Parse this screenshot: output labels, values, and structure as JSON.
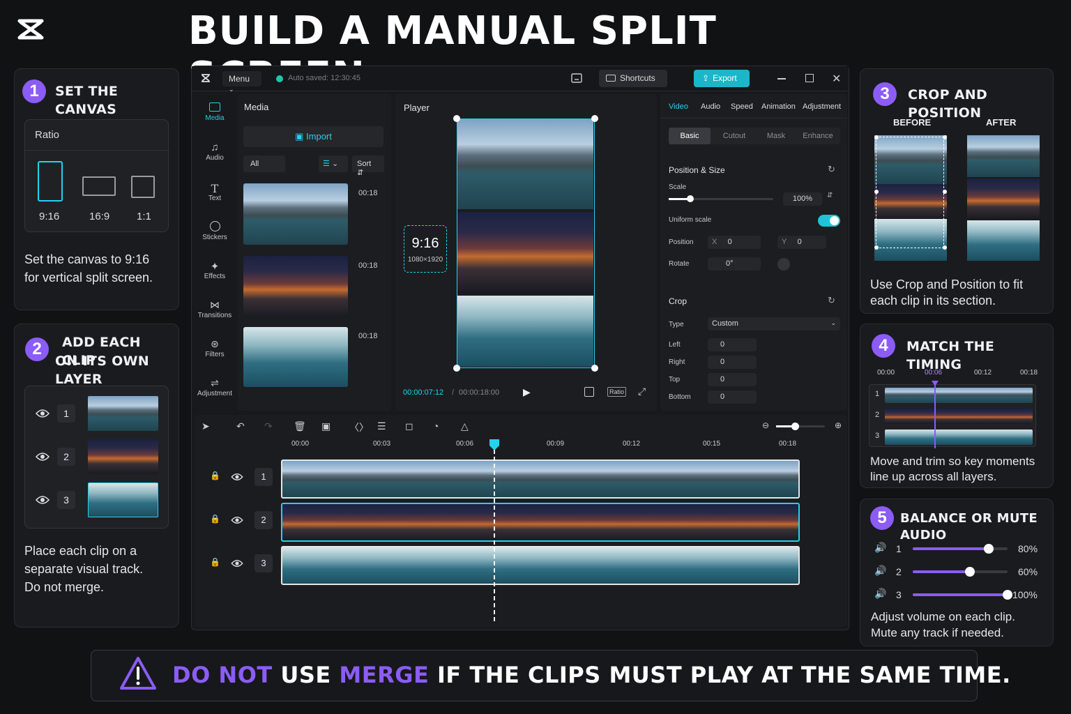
{
  "title": "BUILD A MANUAL SPLIT SCREEN",
  "step1": {
    "num": "1",
    "title": "SET THE CANVAS",
    "ratio_label": "Ratio",
    "ratios": [
      "9:16",
      "16:9",
      "1:1"
    ],
    "desc_line1": "Set the canvas to 9:16",
    "desc_line2": "for vertical split screen."
  },
  "step2": {
    "num": "2",
    "title_line1": "ADD EACH CLIP",
    "title_line2": "ON ITS OWN LAYER",
    "layers": [
      "1",
      "2",
      "3"
    ],
    "desc_line1": "Place each clip on a",
    "desc_line2": "separate visual track.",
    "desc_line3": "Do not merge."
  },
  "step3": {
    "num": "3",
    "title": "CROP AND POSITION",
    "before": "BEFORE",
    "after": "AFTER",
    "desc_line1": "Use Crop and Position to fit",
    "desc_line2": "each clip in its section."
  },
  "step4": {
    "num": "4",
    "title": "MATCH THE TIMING",
    "ticks": [
      "00:00",
      "00:06",
      "00:12",
      "00:18"
    ],
    "tracks": [
      "1",
      "2",
      "3"
    ],
    "desc_line1": "Move and trim so key moments",
    "desc_line2": "line up across all layers."
  },
  "step5": {
    "num": "5",
    "title": "BALANCE OR MUTE AUDIO",
    "rows": [
      {
        "n": "1",
        "pct": "80%",
        "level": 0.8
      },
      {
        "n": "2",
        "pct": "60%",
        "level": 0.6
      },
      {
        "n": "3",
        "pct": "100%",
        "level": 1.0
      }
    ],
    "desc_line1": "Adjust volume on each clip.",
    "desc_line2": "Mute any track if needed."
  },
  "warning": {
    "part1": "DO NOT",
    "part2": " USE ",
    "part3": "MERGE",
    "part4": " IF THE CLIPS MUST PLAY AT THE SAME TIME."
  },
  "editor": {
    "menu": "Menu",
    "autosave": "Auto saved: 12:30:45",
    "shortcuts": "Shortcuts",
    "export": "Export",
    "sidebar": [
      "Media",
      "Audio",
      "Text",
      "Stickers",
      "Effects",
      "Transitions",
      "Filters",
      "Adjustment"
    ],
    "media": {
      "title": "Media",
      "import": "Import",
      "filter_all": "All",
      "sort": "Sort",
      "durations": [
        "00:18",
        "00:18",
        "00:18"
      ]
    },
    "player": {
      "title": "Player",
      "ratio_big": "9:16",
      "ratio_res": "1080×1920",
      "current": "00:00:07:12",
      "sep": "/",
      "total": "00:00:18:00",
      "ratio_btn": "Ratio"
    },
    "props": {
      "tabs": [
        "Video",
        "Audio",
        "Speed",
        "Animation",
        "Adjustment"
      ],
      "subtabs": [
        "Basic",
        "Cutout",
        "Mask",
        "Enhance"
      ],
      "pos_size": "Position & Size",
      "scale": "Scale",
      "scale_val": "100%",
      "uniform": "Uniform scale",
      "position": "Position",
      "x_lbl": "X",
      "x_val": "0",
      "y_lbl": "Y",
      "y_val": "0",
      "rotate": "Rotate",
      "rotate_val": "0°",
      "crop": "Crop",
      "type": "Type",
      "type_val": "Custom",
      "left": "Left",
      "right": "Right",
      "top": "Top",
      "bottom": "Bottom",
      "crop_val": "0"
    },
    "timeline": {
      "ticks": [
        "00:00",
        "00:03",
        "00:06",
        "00:09",
        "00:12",
        "00:15",
        "00:18"
      ],
      "tracks": [
        "1",
        "2",
        "3"
      ]
    }
  },
  "colors": {
    "accent": "#8b5cf6",
    "teal": "#22d3ee",
    "bg": "#111214"
  }
}
